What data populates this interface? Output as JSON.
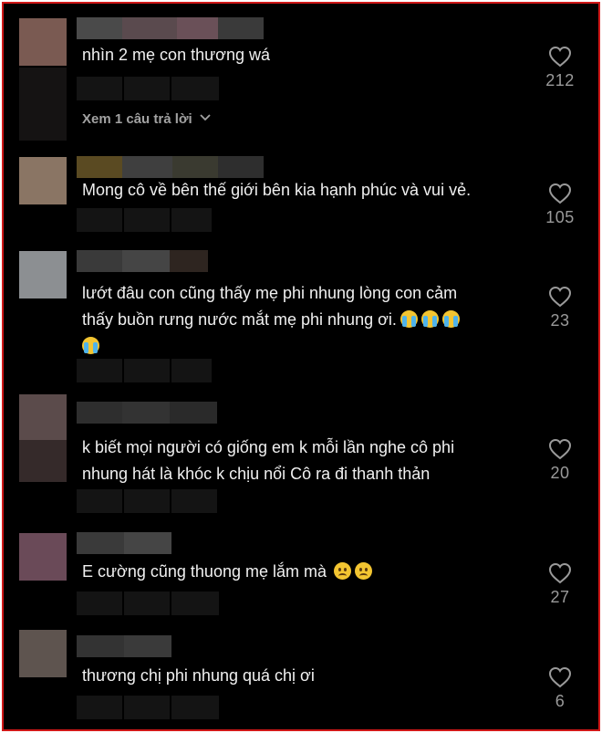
{
  "comments": [
    {
      "text": "nhìn 2 mẹ con thương wá",
      "likes": "212",
      "replies_label": "Xem 1 câu trả lời",
      "avatar_color": "#7a5a52"
    },
    {
      "text": "Mong cô về bên thế giới bên kia hạnh phúc và vui vẻ.",
      "likes": "105",
      "avatar_color": "#8a7564"
    },
    {
      "text_line1": "lướt đâu con cũng thấy mẹ phi nhung lòng con cảm",
      "text_line2": "thấy buồn rưng nước mắt mẹ phi nhung ơi.",
      "likes": "23",
      "avatar_color": "#8c8f92",
      "emojis": [
        "loudly-crying-face",
        "loudly-crying-face",
        "loudly-crying-face",
        "loudly-crying-face"
      ]
    },
    {
      "text_line1": "k biết mọi người có giống em k mỗi lần nghe cô phi",
      "text_line2": "nhung hát là khóc k chịu nổi Cô ra đi thanh thản",
      "likes": "20",
      "avatar_color": "#5b4b4b"
    },
    {
      "text": "E cường cũng thuong mẹ lắm mà",
      "likes": "27",
      "avatar_color": "#6a4a58",
      "emojis": [
        "frowning-face",
        "frowning-face"
      ]
    },
    {
      "text": "thương chị phi nhung quá chị ơi",
      "likes": "6",
      "avatar_color": "#5e544f"
    }
  ],
  "icons": {
    "like": "heart-outline-icon",
    "expand": "chevron-down-icon"
  },
  "colors": {
    "background": "#000000",
    "border": "#d01818",
    "text": "#f0f0f0",
    "muted": "#9a9a9a"
  }
}
